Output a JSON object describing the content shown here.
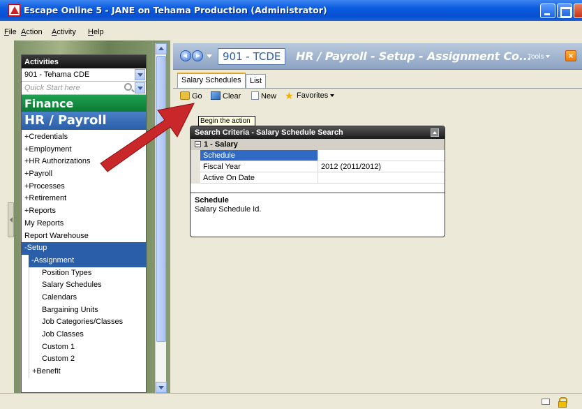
{
  "window": {
    "title": "Escape Online 5 - JANE on Tehama Production (Administrator)"
  },
  "menu": [
    "File",
    "Action",
    "Activity",
    "Help"
  ],
  "left_panel": {
    "header": "Activities",
    "district_combo": "901 - Tehama CDE",
    "quick_start_placeholder": "Quick Start here",
    "finance": "Finance",
    "hr_payroll": "HR / Payroll",
    "items": [
      "+Credentials",
      "+Employment",
      "+HR Authorizations",
      "+Payroll",
      "+Processes",
      "+Retirement",
      "+Reports",
      "My Reports",
      "Report Warehouse",
      "-Setup",
      "-Assignment",
      "Position Types",
      "Salary Schedules",
      "Calendars",
      "Bargaining Units",
      "Job Categories/Classes",
      "Job Classes",
      "Custom 1",
      "Custom 2",
      "+Benefit"
    ]
  },
  "header": {
    "district": "901 - TCDE",
    "breadcrumb": "HR / Payroll - Setup - Assignment Co...",
    "tools": "Tools"
  },
  "tabs": [
    "Salary Schedules",
    "List"
  ],
  "toolbar": {
    "go": "Go",
    "clear": "Clear",
    "new": "New",
    "favorites": "Favorites"
  },
  "tooltip": "Begin the action",
  "search_panel": {
    "title": "Search Criteria - Salary Schedule Search",
    "group": "1 - Salary",
    "rows": [
      {
        "label": "Schedule",
        "value": ""
      },
      {
        "label": "Fiscal Year",
        "value": "2012 (2011/2012)"
      },
      {
        "label": "Active On Date",
        "value": ""
      }
    ],
    "description_title": "Schedule",
    "description_text": "Salary Schedule Id."
  },
  "colors": {
    "finance": "#0b7a34",
    "hr_payroll": "#2a5ea8",
    "selection": "#316ac5",
    "arrow": "#c8282a"
  }
}
